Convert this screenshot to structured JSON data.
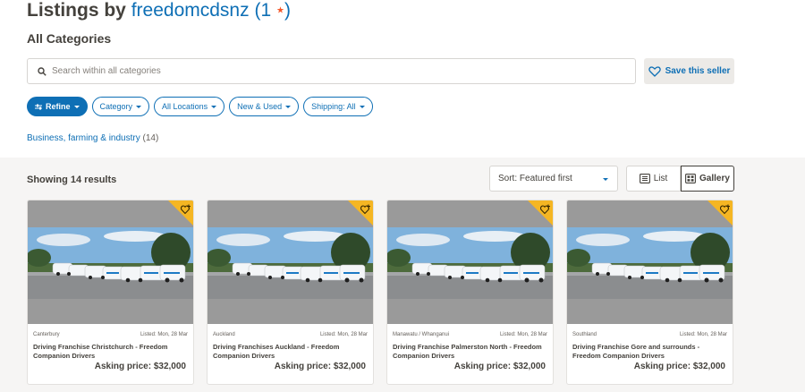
{
  "header": {
    "prefix": "Listings by",
    "seller": "freedomcdsnz",
    "feedback_open": "(1",
    "feedback_close": ")",
    "star": "★",
    "subtitle": "All Categories"
  },
  "search": {
    "placeholder": "Search within all categories",
    "save_label": "Save this seller"
  },
  "filters": [
    {
      "label": "Refine"
    },
    {
      "label": "Category"
    },
    {
      "label": "All Locations"
    },
    {
      "label": "New & Used"
    },
    {
      "label": "Shipping: All"
    }
  ],
  "category": {
    "label": "Business, farming & industry",
    "count": "(14)"
  },
  "results": {
    "showing": "Showing 14 results",
    "sort": "Sort: Featured first",
    "list_label": "List",
    "gallery_label": "Gallery"
  },
  "listings": [
    {
      "location": "Canterbury",
      "listed": "Listed: Mon, 28 Mar",
      "title": "Driving Franchise Christchurch - Freedom Companion Drivers",
      "price": "Asking price: $32,000"
    },
    {
      "location": "Auckland",
      "listed": "Listed: Mon, 28 Mar",
      "title": "Driving Franchises Auckland - Freedom Companion Drivers",
      "price": "Asking price: $32,000"
    },
    {
      "location": "Manawatu / Whanganui",
      "listed": "Listed: Mon, 28 Mar",
      "title": "Driving Franchise Palmerston North - Freedom Companion Drivers",
      "price": "Asking price: $32,000"
    },
    {
      "location": "Southland",
      "listed": "Listed: Mon, 28 Mar",
      "title": "Driving Franchise Gore and surrounds - Freedom Companion Drivers",
      "price": "Asking price: $32,000"
    }
  ],
  "colors": {
    "accent": "#0e6fb5",
    "badge": "#f5b623",
    "star": "#f55a2c"
  }
}
